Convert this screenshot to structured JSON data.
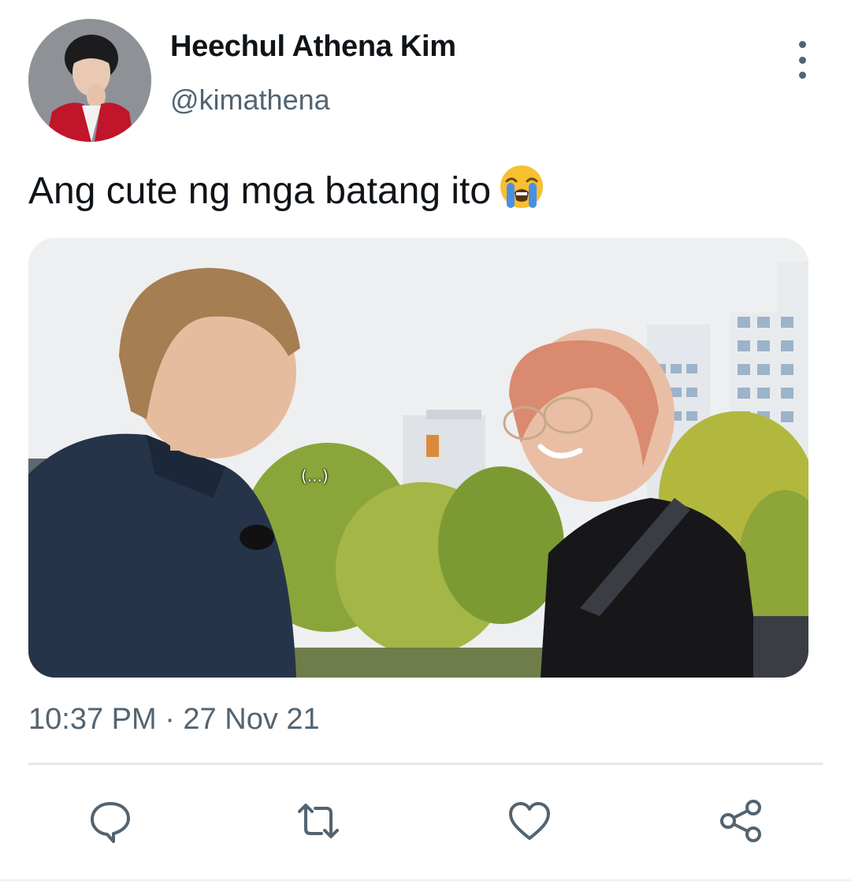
{
  "author": {
    "display_name": "Heechul Athena Kim",
    "handle": "@kimathena",
    "avatar_icon": "profile-photo"
  },
  "tweet": {
    "text": "Ang cute ng mga batang ito",
    "emoji": "loudly-crying-face",
    "media_caption": "(...)",
    "timestamp": "10:37 PM · 27 Nov 21"
  },
  "actions": [
    {
      "name": "reply",
      "icon": "speech-bubble-icon"
    },
    {
      "name": "retweet",
      "icon": "retweet-icon"
    },
    {
      "name": "like",
      "icon": "heart-icon"
    },
    {
      "name": "share",
      "icon": "share-icon"
    }
  ],
  "colors": {
    "text_primary": "#0f1419",
    "text_secondary": "#536471",
    "divider": "#e6e8ea"
  }
}
